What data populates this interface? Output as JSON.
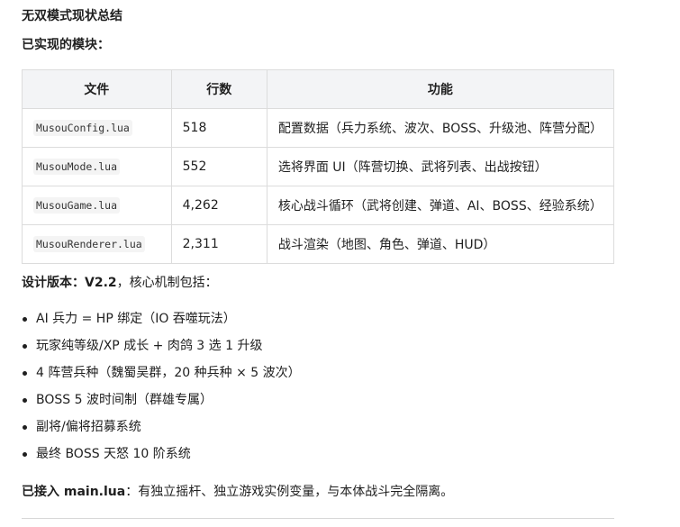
{
  "title": "无双模式现状总结",
  "implemented_heading": "已实现的模块：",
  "table": {
    "headers": [
      "文件",
      "行数",
      "功能"
    ],
    "rows": [
      {
        "file": "MusouConfig.lua",
        "lines": "518",
        "function": "配置数据（兵力系统、波次、BOSS、升级池、阵营分配）"
      },
      {
        "file": "MusouMode.lua",
        "lines": "552",
        "function": "选将界面 UI（阵营切换、武将列表、出战按钮）"
      },
      {
        "file": "MusouGame.lua",
        "lines": "4,262",
        "function": "核心战斗循环（武将创建、弹道、AI、BOSS、经验系统）"
      },
      {
        "file": "MusouRenderer.lua",
        "lines": "2,311",
        "function": "战斗渲染（地图、角色、弹道、HUD）"
      }
    ]
  },
  "version": {
    "label": "设计版本：",
    "value": "V2.2",
    "suffix": "，核心机制包括："
  },
  "features": [
    "AI 兵力 = HP 绑定（IO 吞噬玩法）",
    "玩家纯等级/XP 成长 + 肉鸽 3 选 1 升级",
    "4 阵营兵种（魏蜀吴群，20 种兵种 × 5 波次）",
    "BOSS 5 波时间制（群雄专属）",
    "副将/偏将招募系统",
    "最终 BOSS 天怒 10 阶系统"
  ],
  "footer": {
    "label": "已接入 main.lua",
    "text": "：有独立摇杆、独立游戏实例变量，与本体战斗完全隔离。"
  }
}
